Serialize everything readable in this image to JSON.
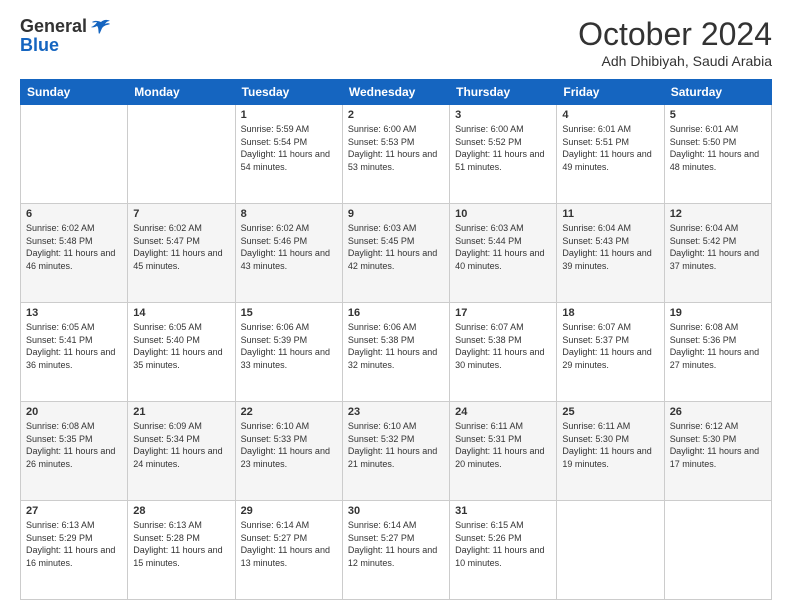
{
  "header": {
    "logo_line1": "General",
    "logo_line2": "Blue",
    "month_title": "October 2024",
    "location": "Adh Dhibiyah, Saudi Arabia"
  },
  "days_of_week": [
    "Sunday",
    "Monday",
    "Tuesday",
    "Wednesday",
    "Thursday",
    "Friday",
    "Saturday"
  ],
  "weeks": [
    [
      {
        "day": "",
        "sunrise": "",
        "sunset": "",
        "daylight": ""
      },
      {
        "day": "",
        "sunrise": "",
        "sunset": "",
        "daylight": ""
      },
      {
        "day": "1",
        "sunrise": "Sunrise: 5:59 AM",
        "sunset": "Sunset: 5:54 PM",
        "daylight": "Daylight: 11 hours and 54 minutes."
      },
      {
        "day": "2",
        "sunrise": "Sunrise: 6:00 AM",
        "sunset": "Sunset: 5:53 PM",
        "daylight": "Daylight: 11 hours and 53 minutes."
      },
      {
        "day": "3",
        "sunrise": "Sunrise: 6:00 AM",
        "sunset": "Sunset: 5:52 PM",
        "daylight": "Daylight: 11 hours and 51 minutes."
      },
      {
        "day": "4",
        "sunrise": "Sunrise: 6:01 AM",
        "sunset": "Sunset: 5:51 PM",
        "daylight": "Daylight: 11 hours and 49 minutes."
      },
      {
        "day": "5",
        "sunrise": "Sunrise: 6:01 AM",
        "sunset": "Sunset: 5:50 PM",
        "daylight": "Daylight: 11 hours and 48 minutes."
      }
    ],
    [
      {
        "day": "6",
        "sunrise": "Sunrise: 6:02 AM",
        "sunset": "Sunset: 5:48 PM",
        "daylight": "Daylight: 11 hours and 46 minutes."
      },
      {
        "day": "7",
        "sunrise": "Sunrise: 6:02 AM",
        "sunset": "Sunset: 5:47 PM",
        "daylight": "Daylight: 11 hours and 45 minutes."
      },
      {
        "day": "8",
        "sunrise": "Sunrise: 6:02 AM",
        "sunset": "Sunset: 5:46 PM",
        "daylight": "Daylight: 11 hours and 43 minutes."
      },
      {
        "day": "9",
        "sunrise": "Sunrise: 6:03 AM",
        "sunset": "Sunset: 5:45 PM",
        "daylight": "Daylight: 11 hours and 42 minutes."
      },
      {
        "day": "10",
        "sunrise": "Sunrise: 6:03 AM",
        "sunset": "Sunset: 5:44 PM",
        "daylight": "Daylight: 11 hours and 40 minutes."
      },
      {
        "day": "11",
        "sunrise": "Sunrise: 6:04 AM",
        "sunset": "Sunset: 5:43 PM",
        "daylight": "Daylight: 11 hours and 39 minutes."
      },
      {
        "day": "12",
        "sunrise": "Sunrise: 6:04 AM",
        "sunset": "Sunset: 5:42 PM",
        "daylight": "Daylight: 11 hours and 37 minutes."
      }
    ],
    [
      {
        "day": "13",
        "sunrise": "Sunrise: 6:05 AM",
        "sunset": "Sunset: 5:41 PM",
        "daylight": "Daylight: 11 hours and 36 minutes."
      },
      {
        "day": "14",
        "sunrise": "Sunrise: 6:05 AM",
        "sunset": "Sunset: 5:40 PM",
        "daylight": "Daylight: 11 hours and 35 minutes."
      },
      {
        "day": "15",
        "sunrise": "Sunrise: 6:06 AM",
        "sunset": "Sunset: 5:39 PM",
        "daylight": "Daylight: 11 hours and 33 minutes."
      },
      {
        "day": "16",
        "sunrise": "Sunrise: 6:06 AM",
        "sunset": "Sunset: 5:38 PM",
        "daylight": "Daylight: 11 hours and 32 minutes."
      },
      {
        "day": "17",
        "sunrise": "Sunrise: 6:07 AM",
        "sunset": "Sunset: 5:38 PM",
        "daylight": "Daylight: 11 hours and 30 minutes."
      },
      {
        "day": "18",
        "sunrise": "Sunrise: 6:07 AM",
        "sunset": "Sunset: 5:37 PM",
        "daylight": "Daylight: 11 hours and 29 minutes."
      },
      {
        "day": "19",
        "sunrise": "Sunrise: 6:08 AM",
        "sunset": "Sunset: 5:36 PM",
        "daylight": "Daylight: 11 hours and 27 minutes."
      }
    ],
    [
      {
        "day": "20",
        "sunrise": "Sunrise: 6:08 AM",
        "sunset": "Sunset: 5:35 PM",
        "daylight": "Daylight: 11 hours and 26 minutes."
      },
      {
        "day": "21",
        "sunrise": "Sunrise: 6:09 AM",
        "sunset": "Sunset: 5:34 PM",
        "daylight": "Daylight: 11 hours and 24 minutes."
      },
      {
        "day": "22",
        "sunrise": "Sunrise: 6:10 AM",
        "sunset": "Sunset: 5:33 PM",
        "daylight": "Daylight: 11 hours and 23 minutes."
      },
      {
        "day": "23",
        "sunrise": "Sunrise: 6:10 AM",
        "sunset": "Sunset: 5:32 PM",
        "daylight": "Daylight: 11 hours and 21 minutes."
      },
      {
        "day": "24",
        "sunrise": "Sunrise: 6:11 AM",
        "sunset": "Sunset: 5:31 PM",
        "daylight": "Daylight: 11 hours and 20 minutes."
      },
      {
        "day": "25",
        "sunrise": "Sunrise: 6:11 AM",
        "sunset": "Sunset: 5:30 PM",
        "daylight": "Daylight: 11 hours and 19 minutes."
      },
      {
        "day": "26",
        "sunrise": "Sunrise: 6:12 AM",
        "sunset": "Sunset: 5:30 PM",
        "daylight": "Daylight: 11 hours and 17 minutes."
      }
    ],
    [
      {
        "day": "27",
        "sunrise": "Sunrise: 6:13 AM",
        "sunset": "Sunset: 5:29 PM",
        "daylight": "Daylight: 11 hours and 16 minutes."
      },
      {
        "day": "28",
        "sunrise": "Sunrise: 6:13 AM",
        "sunset": "Sunset: 5:28 PM",
        "daylight": "Daylight: 11 hours and 15 minutes."
      },
      {
        "day": "29",
        "sunrise": "Sunrise: 6:14 AM",
        "sunset": "Sunset: 5:27 PM",
        "daylight": "Daylight: 11 hours and 13 minutes."
      },
      {
        "day": "30",
        "sunrise": "Sunrise: 6:14 AM",
        "sunset": "Sunset: 5:27 PM",
        "daylight": "Daylight: 11 hours and 12 minutes."
      },
      {
        "day": "31",
        "sunrise": "Sunrise: 6:15 AM",
        "sunset": "Sunset: 5:26 PM",
        "daylight": "Daylight: 11 hours and 10 minutes."
      },
      {
        "day": "",
        "sunrise": "",
        "sunset": "",
        "daylight": ""
      },
      {
        "day": "",
        "sunrise": "",
        "sunset": "",
        "daylight": ""
      }
    ]
  ]
}
